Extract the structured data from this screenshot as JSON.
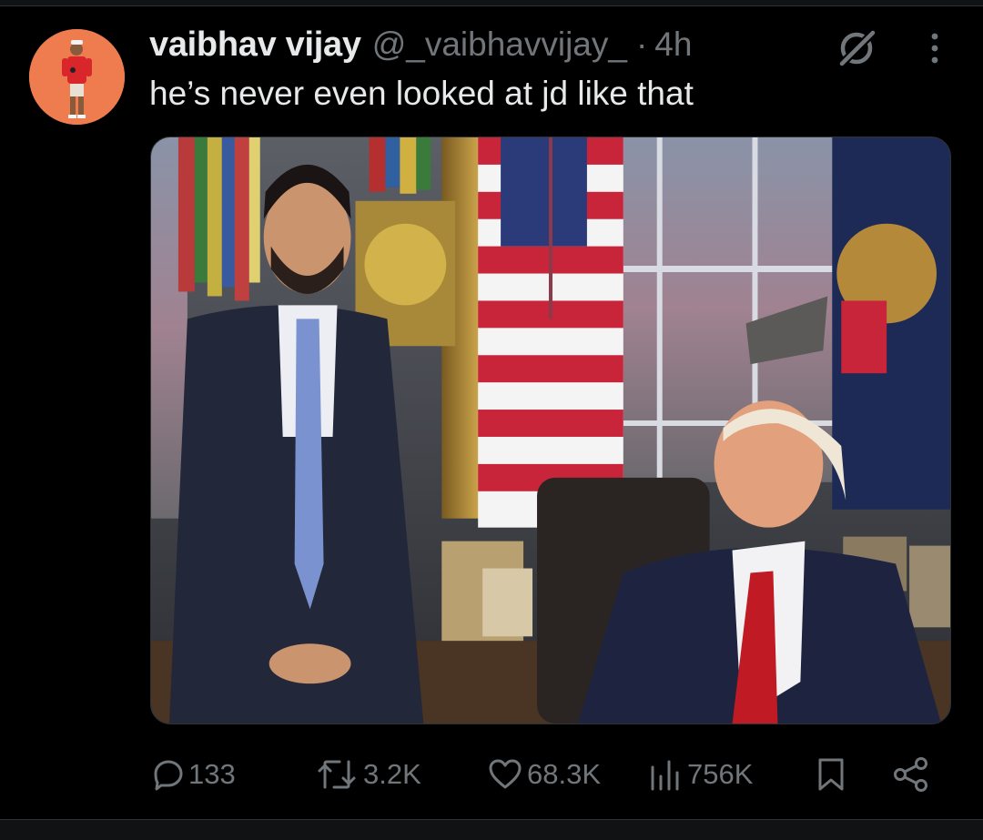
{
  "tweet": {
    "display_name": "vaibhav vijay",
    "handle": "@_vaibhavvijay_",
    "separator": "·",
    "timestamp": "4h",
    "text": "he’s never even looked at jd like that"
  },
  "avatar": {
    "background_color": "#ee7c4e"
  },
  "icons": {
    "grok": "grok-icon",
    "more": "more-icon"
  },
  "actions": {
    "replies": {
      "icon": "reply-icon",
      "count": "133"
    },
    "reposts": {
      "icon": "repost-icon",
      "count": "3.2K"
    },
    "likes": {
      "icon": "like-icon",
      "count": "68.3K"
    },
    "views": {
      "icon": "views-icon",
      "count": "756K"
    },
    "bookmark": {
      "icon": "bookmark-icon"
    },
    "share": {
      "icon": "share-icon"
    }
  },
  "colors": {
    "background": "#000000",
    "text_primary": "#e7e9ea",
    "text_secondary": "#71767b",
    "divider": "#2f3336"
  }
}
